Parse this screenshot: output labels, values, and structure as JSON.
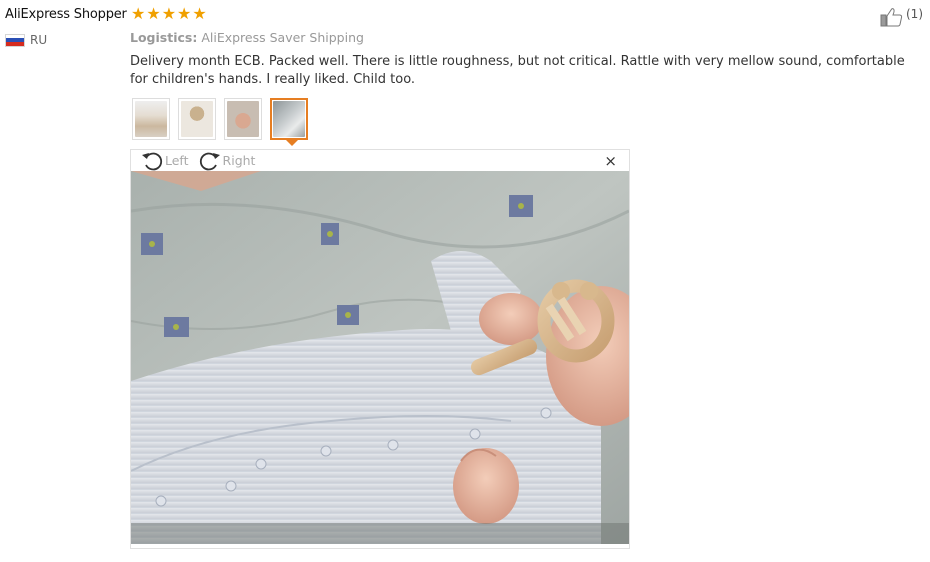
{
  "review": {
    "user_name": "AliExpress Shopper",
    "country_code": "RU",
    "rating": 5,
    "star_color": "#f0a000",
    "helpful_count": "(1)",
    "logistics_label": "Logistics:",
    "logistics_value": "AliExpress Saver Shipping",
    "text": "Delivery month ECB. Packed well. There is little roughness, but not critical. Rattle with very mellow sound, comfortable for children's hands. I really liked. Child too."
  },
  "thumbnails": [
    {
      "id": "photo-1",
      "active": false
    },
    {
      "id": "photo-2",
      "active": false
    },
    {
      "id": "photo-3",
      "active": false
    },
    {
      "id": "photo-4",
      "active": true
    }
  ],
  "viewer": {
    "rotate_left_label": "Left",
    "rotate_right_label": "Right",
    "close_label": "×"
  },
  "colors": {
    "accent": "#e67e22",
    "muted": "#999999"
  }
}
